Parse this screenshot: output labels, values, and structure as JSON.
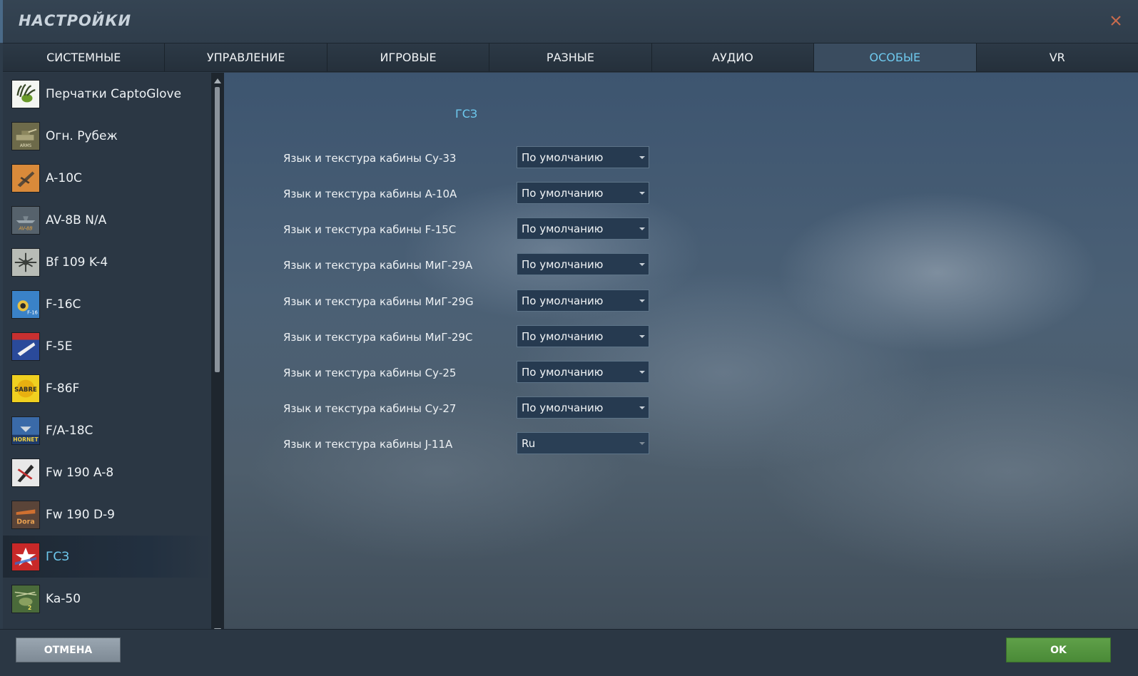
{
  "window": {
    "title": "НАСТРОЙКИ"
  },
  "tabs": [
    {
      "label": "СИСТЕМНЫЕ"
    },
    {
      "label": "УПРАВЛЕНИЕ"
    },
    {
      "label": "ИГРОВЫЕ"
    },
    {
      "label": "РАЗНЫЕ"
    },
    {
      "label": "АУДИО"
    },
    {
      "label": "ОСОБЫЕ",
      "active": true
    },
    {
      "label": "VR"
    }
  ],
  "sidebar": {
    "items": [
      {
        "label": "Перчатки CaptoGlove",
        "icon": "captoglove-icon"
      },
      {
        "label": "Огн. Рубеж",
        "icon": "combined-arms-icon"
      },
      {
        "label": "A-10C",
        "icon": "a10c-icon"
      },
      {
        "label": "AV-8B N/A",
        "icon": "av8b-icon"
      },
      {
        "label": "Bf 109 K-4",
        "icon": "bf109-icon"
      },
      {
        "label": "F-16C",
        "icon": "f16c-icon"
      },
      {
        "label": "F-5E",
        "icon": "f5e-icon"
      },
      {
        "label": "F-86F",
        "icon": "f86f-icon"
      },
      {
        "label": "F/A-18C",
        "icon": "fa18c-icon"
      },
      {
        "label": "Fw 190 A-8",
        "icon": "fw190a8-icon"
      },
      {
        "label": "Fw 190 D-9",
        "icon": "fw190d9-icon"
      },
      {
        "label": "ГСЗ",
        "icon": "flaming-cliffs-icon",
        "active": true
      },
      {
        "label": "Ka-50",
        "icon": "ka50-icon"
      }
    ]
  },
  "main": {
    "section_title": "ГСЗ",
    "settings": [
      {
        "label": "Язык и текстура кабины Су-33",
        "value": "По умолчанию"
      },
      {
        "label": "Язык и текстура кабины A-10A",
        "value": "По умолчанию"
      },
      {
        "label": "Язык и текстура кабины F-15C",
        "value": "По умолчанию"
      },
      {
        "label": "Язык и текстура кабины МиГ-29А",
        "value": "По умолчанию"
      },
      {
        "label": "Язык и текстура кабины МиГ-29G",
        "value": "По умолчанию"
      },
      {
        "label": "Язык и текстура кабины МиГ-29С",
        "value": "По умолчанию"
      },
      {
        "label": "Язык и текстура кабины Су-25",
        "value": "По умолчанию"
      },
      {
        "label": "Язык и текстура кабины Су-27",
        "value": "По умолчанию"
      },
      {
        "label": "Язык и текстура кабины J-11A",
        "value": "Ru"
      }
    ]
  },
  "footer": {
    "cancel_label": "ОТМЕНА",
    "ok_label": "OK"
  },
  "colors": {
    "accent": "#6ec9ee",
    "ok_button": "#56963f",
    "cancel_button": "#8c98a3"
  }
}
